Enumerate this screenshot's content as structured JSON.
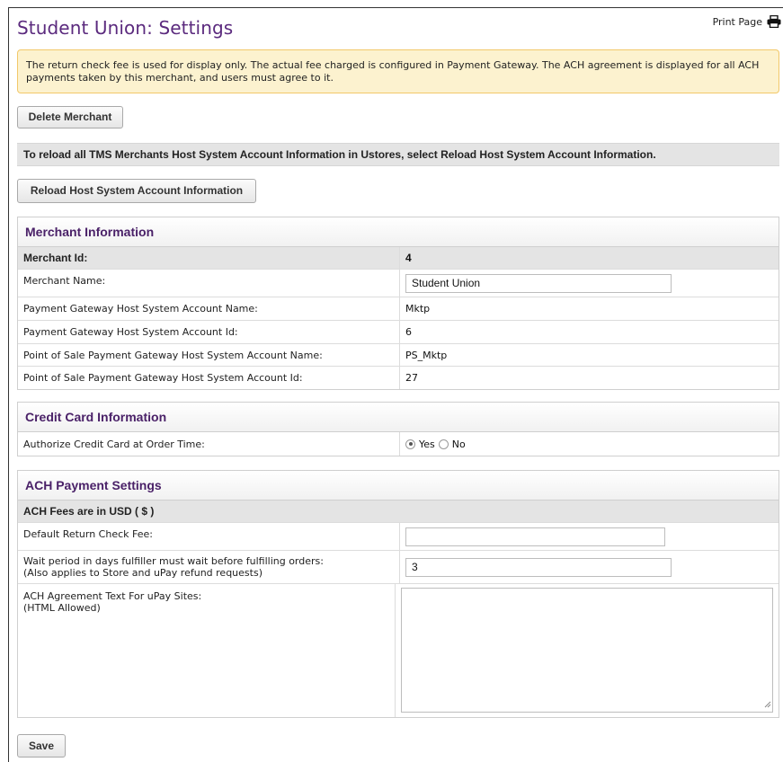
{
  "page": {
    "title": "Student Union: Settings",
    "print_label": "Print Page",
    "print_icon": "printer-icon"
  },
  "notice": {
    "text": "The return check fee is used for display only. The actual fee charged is configured in Payment Gateway. The ACH agreement is displayed for all ACH payments taken by this merchant, and users must agree to it."
  },
  "buttons": {
    "delete_merchant": "Delete Merchant",
    "reload_host": "Reload Host System Account Information",
    "save": "Save"
  },
  "reload_bar": {
    "text": "To reload all TMS Merchants Host System Account Information in Ustores, select Reload Host System Account Information."
  },
  "merchant_info": {
    "heading": "Merchant Information",
    "merchant_id_label": "Merchant Id:",
    "merchant_id_value": "4",
    "merchant_name_label": "Merchant Name:",
    "merchant_name_value": "Student Union",
    "pg_account_name_label": "Payment Gateway Host System Account Name:",
    "pg_account_name_value": "Mktp",
    "pg_account_id_label": "Payment Gateway Host System Account Id:",
    "pg_account_id_value": "6",
    "pos_account_name_label": "Point of Sale Payment Gateway Host System Account Name:",
    "pos_account_name_value": "PS_Mktp",
    "pos_account_id_label": "Point of Sale Payment Gateway Host System Account Id:",
    "pos_account_id_value": "27"
  },
  "credit_card": {
    "heading": "Credit Card Information",
    "authorize_label": "Authorize Credit Card at Order Time:",
    "options": [
      "Yes",
      "No"
    ],
    "selected": "Yes"
  },
  "ach": {
    "heading": "ACH Payment Settings",
    "fees_currency": "ACH Fees are in USD ( $ )",
    "return_check_fee_label": "Default Return Check Fee:",
    "return_check_fee_value": "",
    "wait_period_label_1": "Wait period in days fulfiller must wait before fulfilling orders:",
    "wait_period_label_2": "(Also applies to Store and uPay refund requests)",
    "wait_period_value": "3",
    "agreement_label_1": "ACH Agreement Text For uPay Sites:",
    "agreement_label_2": "(HTML Allowed)",
    "agreement_value": ""
  }
}
